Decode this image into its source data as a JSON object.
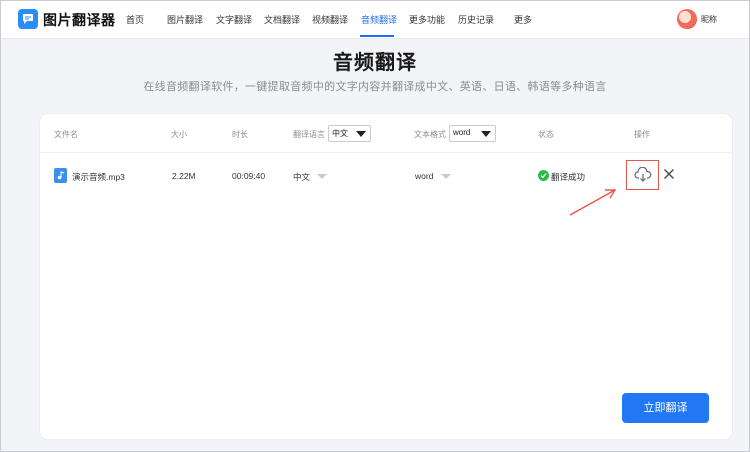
{
  "app": {
    "title": "图片翻译器"
  },
  "nav": {
    "items": [
      {
        "label": "首页"
      },
      {
        "label": "图片翻译"
      },
      {
        "label": "文字翻译"
      },
      {
        "label": "文档翻译"
      },
      {
        "label": "视频翻译"
      },
      {
        "label": "音频翻译",
        "active": true
      },
      {
        "label": "更多功能"
      },
      {
        "label": "历史记录"
      },
      {
        "label": "更多"
      }
    ],
    "user_name": "昵称"
  },
  "hero": {
    "title": "音频翻译",
    "subtitle": "在线音频翻译软件，一键提取音频中的文字内容并翻译成中文、英语、日语、韩语等多种语言"
  },
  "table": {
    "headers": {
      "file_name": "文件名",
      "size": "大小",
      "duration": "时长",
      "language": "翻译语言",
      "format": "文本格式",
      "status": "状态",
      "action": "操作"
    },
    "language_select": "中文",
    "format_select": "word",
    "rows": [
      {
        "file_name": "演示音频.mp3",
        "size": "2.22M",
        "duration": "00:09:40",
        "language": "中文",
        "format": "word",
        "status": "翻译成功"
      }
    ]
  },
  "actions": {
    "translate_button": "立即翻译"
  },
  "colors": {
    "accent": "#1f6ff0",
    "button": "#2277f2",
    "success": "#2db94d",
    "highlight": "#e8554a"
  },
  "icons": [
    "logo-icon",
    "audio-file-icon",
    "check-circle-icon",
    "cloud-download-icon",
    "close-icon",
    "dropdown-arrow-icon"
  ]
}
